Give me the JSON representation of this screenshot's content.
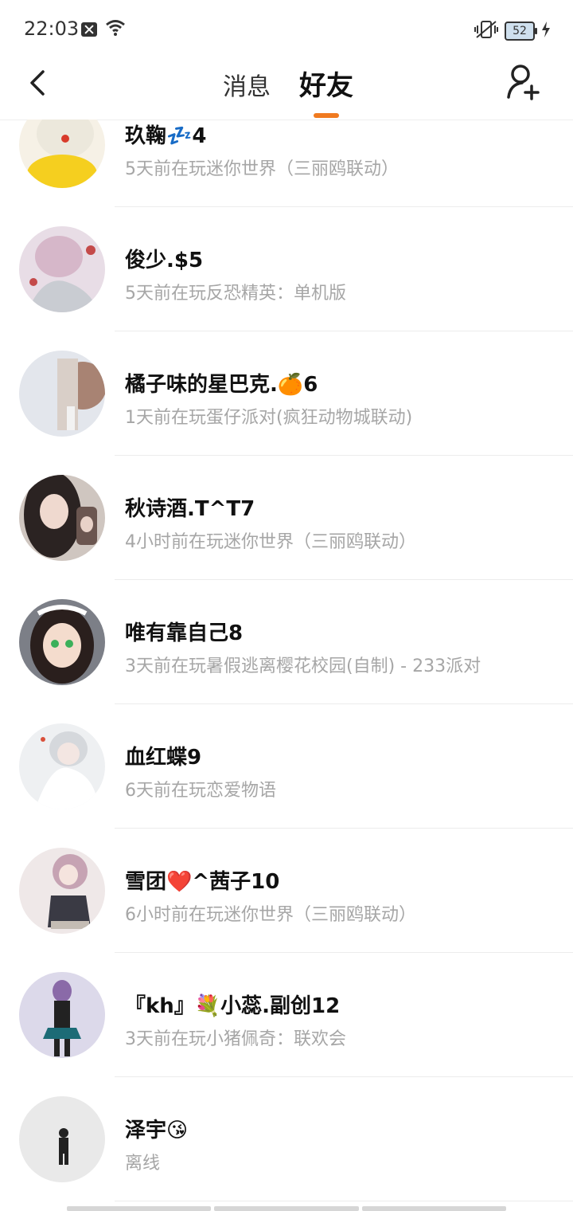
{
  "status_bar": {
    "time": "22:03",
    "battery": "52"
  },
  "header": {
    "tab_messages": "消息",
    "tab_friends": "好友"
  },
  "friends": [
    {
      "name": "玖鞠💤4",
      "status": "5天前在玩迷你世界（三丽鸥联动）",
      "avatar_color": "#f3e7a0"
    },
    {
      "name": "俊少.$5",
      "status": "5天前在玩反恐精英：单机版",
      "avatar_color": "#d9c9d6"
    },
    {
      "name": "橘子味的星巴克.🍊6",
      "status": "1天前在玩蛋仔派对(疯狂动物城联动)",
      "avatar_color": "#c9b2a8"
    },
    {
      "name": "秋诗酒.T^T7",
      "status": "4小时前在玩迷你世界（三丽鸥联动）",
      "avatar_color": "#5a4a45"
    },
    {
      "name": "唯有靠自己8",
      "status": "3天前在玩暑假逃离樱花校园(自制) - 233派对",
      "avatar_color": "#8a8d95"
    },
    {
      "name": "血红蝶9",
      "status": "6天前在玩恋爱物语",
      "avatar_color": "#e6e8ea"
    },
    {
      "name": "雪团❤️^茜子10",
      "status": "6小时前在玩迷你世界（三丽鸥联动）",
      "avatar_color": "#cbb3b8"
    },
    {
      "name": "『kh』💐小蕊.副创12",
      "status": "3天前在玩小猪佩奇：联欢会",
      "avatar_color": "#d7d5e6"
    },
    {
      "name": "泽宇😘",
      "status": "离线",
      "avatar_color": "#e8e8e8"
    }
  ]
}
